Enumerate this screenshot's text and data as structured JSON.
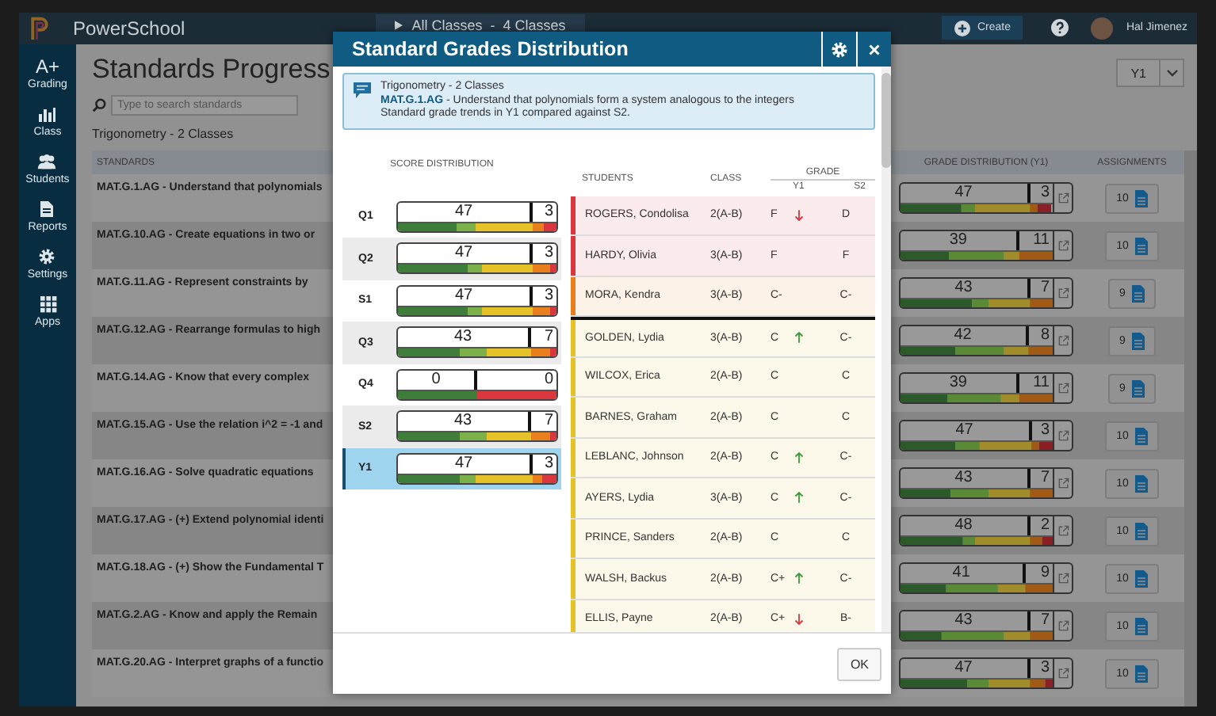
{
  "top_bar": {
    "brand": "PowerSchool",
    "class_switcher": "All Classes  -  4 Classes",
    "create_button": "Create",
    "user_name": "Hal Jimenez"
  },
  "sidebar": {
    "items": [
      {
        "kind": "grading",
        "icon_text": "A+",
        "label": "Grading"
      },
      {
        "kind": "class",
        "label": "Class"
      },
      {
        "kind": "students",
        "label": "Students"
      },
      {
        "kind": "reports",
        "label": "Reports"
      },
      {
        "kind": "settings",
        "label": "Settings"
      },
      {
        "kind": "apps",
        "label": "Apps"
      }
    ]
  },
  "page": {
    "title": "Standards Progress",
    "search": {
      "placeholder": "Type to search standards"
    },
    "subtitle": "Trigonometry - 2 Classes",
    "term_select": "Y1"
  },
  "table": {
    "columns": [
      "STANDARDS",
      "GRADE DISTRIBUTION (Y1)",
      "ASSIGNMENTS"
    ],
    "rows": [
      {
        "standard": "MAT.G.1.AG - Understand that polynomials",
        "above": "47",
        "below": "3",
        "level": 0.85,
        "assignments": "10"
      },
      {
        "standard": "MAT.G.10.AG - Create equations in two or",
        "above": "39",
        "below": "11",
        "level": 0.78,
        "assignments": "10"
      },
      {
        "standard": "MAT.G.11.AG - Represent constraints by",
        "above": "43",
        "below": "7",
        "level": 0.85,
        "assignments": "9"
      },
      {
        "standard": "MAT.G.12.AG - Rearrange formulas to high",
        "above": "42",
        "below": "8",
        "level": 0.84,
        "assignments": "9"
      },
      {
        "standard": "MAT.G.14.AG - Know that every complex",
        "above": "39",
        "below": "11",
        "level": 0.78,
        "assignments": "9"
      },
      {
        "standard": "MAT.G.15.AG - Use the relation i^2 = -1 and",
        "above": "47",
        "below": "3",
        "level": 0.86,
        "assignments": "10"
      },
      {
        "standard": "MAT.G.16.AG - Solve quadratic equations",
        "above": "43",
        "below": "7",
        "level": 0.85,
        "assignments": "10"
      },
      {
        "standard": "MAT.G.17.AG - (+) Extend polynomial identi",
        "above": "48",
        "below": "2",
        "level": 0.85,
        "assignments": "10"
      },
      {
        "standard": "MAT.G.18.AG - (+) Show the Fundamental T",
        "above": "41",
        "below": "9",
        "level": 0.82,
        "assignments": "10"
      },
      {
        "standard": "MAT.G.2.AG - Know and apply the Remain",
        "above": "43",
        "below": "7",
        "level": 0.85,
        "assignments": "10"
      },
      {
        "standard": "MAT.G.20.AG - Interpret graphs of a functio",
        "above": "47",
        "below": "3",
        "level": 0.85,
        "assignments": "10"
      }
    ]
  },
  "dialog": {
    "title": "Standard Grades Distribution",
    "info": {
      "heading": "Trigonometry - 2 Classes",
      "standard": "**MAT.G.1.AG** - Understand that polynomials form a system analogous to the integers",
      "note": "Standard grade trends in Y1 compared against S2."
    },
    "score_header": "SCORE DISTRIBUTION",
    "score_rows": [
      {
        "label": "Q1",
        "selected": false,
        "above": "47",
        "below": "3",
        "level": 0.85
      },
      {
        "label": "Q2",
        "selected": false,
        "above": "47",
        "below": "3",
        "level": 0.85
      },
      {
        "label": "S1",
        "selected": false,
        "above": "47",
        "below": "3",
        "level": 0.85
      },
      {
        "label": "Q3",
        "selected": false,
        "above": "43",
        "below": "7",
        "level": 0.84
      },
      {
        "label": "Q4",
        "selected": false,
        "above": "0",
        "below": "0",
        "level": 0.5
      },
      {
        "label": "S2",
        "selected": false,
        "above": "43",
        "below": "7",
        "level": 0.84
      },
      {
        "label": "Y1",
        "selected": true,
        "above": "47",
        "below": "3",
        "level": 0.85
      }
    ],
    "student_columns": {
      "students": "STUDENTS",
      "class": "CLASS",
      "grade": "GRADE",
      "y1": "Y1",
      "s2": "S2"
    },
    "students": [
      {
        "name": "ROGERS, Condolisa",
        "class": "2(A-B)",
        "y1": "F",
        "kind": "falling",
        "s2": "D",
        "color": "#d9363e",
        "cutoff": false
      },
      {
        "name": "HARDY, Olivia",
        "class": "3(A-B)",
        "y1": "F",
        "kind": "steady",
        "s2": "F",
        "color": "#d9363e",
        "cutoff": false
      },
      {
        "name": "MORA, Kendra",
        "class": "3(A-B)",
        "y1": "C-",
        "kind": "steady",
        "s2": "C-",
        "color": "#e87f1c",
        "cutoff": false
      },
      {
        "name": "GOLDEN, Lydia",
        "class": "3(A-B)",
        "y1": "C",
        "kind": "rising",
        "s2": "C-",
        "color": "#e6c229",
        "cutoff": true
      },
      {
        "name": "WILCOX, Erica",
        "class": "2(A-B)",
        "y1": "C",
        "kind": "steady",
        "s2": "C",
        "color": "#e6c229",
        "cutoff": false
      },
      {
        "name": "BARNES, Graham",
        "class": "2(A-B)",
        "y1": "C",
        "kind": "steady",
        "s2": "C",
        "color": "#e6c229",
        "cutoff": false
      },
      {
        "name": "LEBLANC, Johnson",
        "class": "2(A-B)",
        "y1": "C",
        "kind": "rising",
        "s2": "C-",
        "color": "#e6c229",
        "cutoff": false
      },
      {
        "name": "AYERS, Lydia",
        "class": "3(A-B)",
        "y1": "C",
        "kind": "rising",
        "s2": "C-",
        "color": "#e6c229",
        "cutoff": false
      },
      {
        "name": "PRINCE, Sanders",
        "class": "2(A-B)",
        "y1": "C",
        "kind": "steady",
        "s2": "C",
        "color": "#e6c229",
        "cutoff": false
      },
      {
        "name": "WALSH, Backus",
        "class": "2(A-B)",
        "y1": "C+",
        "kind": "rising",
        "s2": "C-",
        "color": "#e6c229",
        "cutoff": false
      },
      {
        "name": "ELLIS, Payne",
        "class": "2(A-B)",
        "y1": "C+",
        "kind": "falling",
        "s2": "B-",
        "color": "#e6c229",
        "cutoff": false
      }
    ],
    "ok_button": "OK"
  }
}
